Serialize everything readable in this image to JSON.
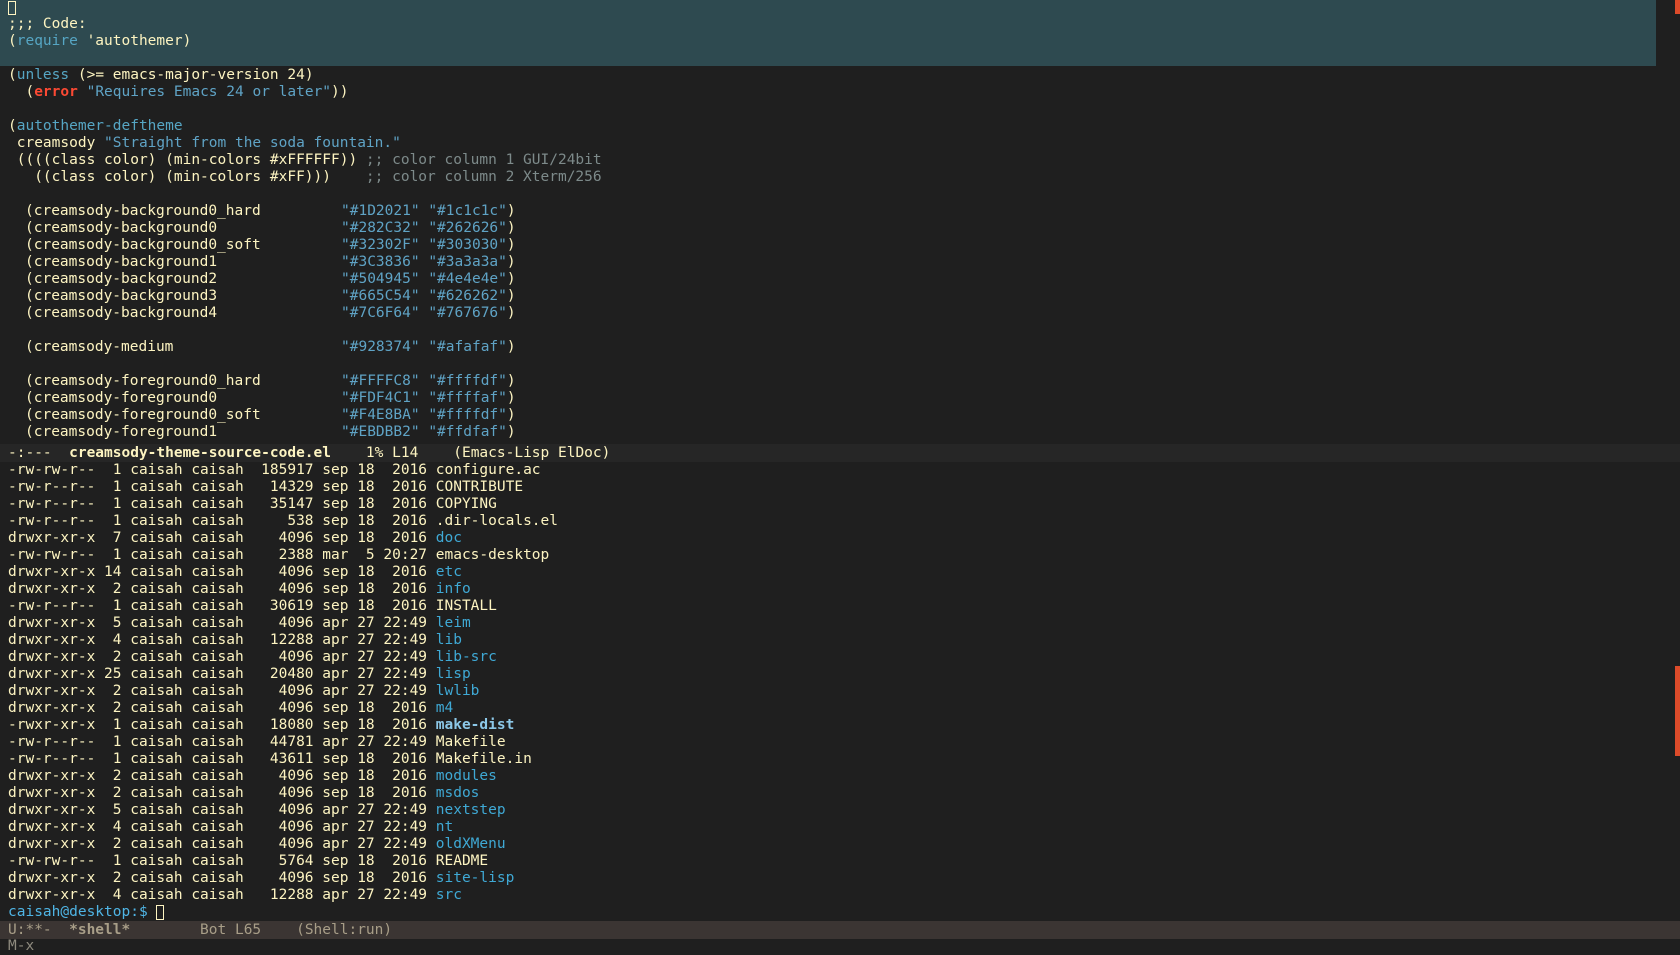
{
  "editor": {
    "comment_code": ";;; Code:",
    "require_kw": "require",
    "require_arg": " 'autothemer)",
    "unless_kw": "unless",
    "unless_rest": " (>= emacs-major-version 24)",
    "error_kw": "error",
    "error_str": "\"Requires Emacs 24 or later\"",
    "deftheme_kw": "autothemer-deftheme",
    "theme_name": " creamsody ",
    "theme_desc": "\"Straight from the soda fountain.\"",
    "class1": " ((((class color) (min-colors #xFFFFFF)) ",
    "class1_comment": ";; color column 1 GUI/24bit",
    "class2": "   ((class color) (min-colors #xFF)))    ",
    "class2_comment": ";; color column 2 Xterm/256",
    "colors": [
      {
        "name": "(creamsody-background0_hard",
        "c1": "\"#1D2021\"",
        "c2": "\"#1c1c1c\""
      },
      {
        "name": "(creamsody-background0",
        "c1": "\"#282C32\"",
        "c2": "\"#262626\""
      },
      {
        "name": "(creamsody-background0_soft",
        "c1": "\"#32302F\"",
        "c2": "\"#303030\""
      },
      {
        "name": "(creamsody-background1",
        "c1": "\"#3C3836\"",
        "c2": "\"#3a3a3a\""
      },
      {
        "name": "(creamsody-background2",
        "c1": "\"#504945\"",
        "c2": "\"#4e4e4e\""
      },
      {
        "name": "(creamsody-background3",
        "c1": "\"#665C54\"",
        "c2": "\"#626262\""
      },
      {
        "name": "(creamsody-background4",
        "c1": "\"#7C6F64\"",
        "c2": "\"#767676\""
      },
      {
        "name": "(creamsody-medium",
        "c1": "\"#928374\"",
        "c2": "\"#afafaf\""
      },
      {
        "name": "(creamsody-foreground0_hard",
        "c1": "\"#FFFFC8\"",
        "c2": "\"#ffffdf\""
      },
      {
        "name": "(creamsody-foreground0",
        "c1": "\"#FDF4C1\"",
        "c2": "\"#ffffaf\""
      },
      {
        "name": "(creamsody-foreground0_soft",
        "c1": "\"#F4E8BA\"",
        "c2": "\"#ffffdf\""
      },
      {
        "name": "(creamsody-foreground1",
        "c1": "\"#EBDBB2\"",
        "c2": "\"#ffdfaf\""
      }
    ]
  },
  "mode_line_top": {
    "status": "-:---  ",
    "buffer": "creamsody-theme-source-code.el",
    "position": "    1% L14    ",
    "modes": "(Emacs-Lisp ElDoc)"
  },
  "listing": [
    {
      "perm": "-rw-rw-r--",
      "links": "1",
      "user": "caisah",
      "group": "caisah",
      "size": "185917",
      "month": "sep",
      "day": "18",
      "time": "2016",
      "name": "configure.ac",
      "kind": "file"
    },
    {
      "perm": "-rw-r--r--",
      "links": "1",
      "user": "caisah",
      "group": "caisah",
      "size": "14329",
      "month": "sep",
      "day": "18",
      "time": "2016",
      "name": "CONTRIBUTE",
      "kind": "file"
    },
    {
      "perm": "-rw-r--r--",
      "links": "1",
      "user": "caisah",
      "group": "caisah",
      "size": "35147",
      "month": "sep",
      "day": "18",
      "time": "2016",
      "name": "COPYING",
      "kind": "file"
    },
    {
      "perm": "-rw-r--r--",
      "links": "1",
      "user": "caisah",
      "group": "caisah",
      "size": "538",
      "month": "sep",
      "day": "18",
      "time": "2016",
      "name": ".dir-locals.el",
      "kind": "file"
    },
    {
      "perm": "drwxr-xr-x",
      "links": "7",
      "user": "caisah",
      "group": "caisah",
      "size": "4096",
      "month": "sep",
      "day": "18",
      "time": "2016",
      "name": "doc",
      "kind": "dir"
    },
    {
      "perm": "-rw-rw-r--",
      "links": "1",
      "user": "caisah",
      "group": "caisah",
      "size": "2388",
      "month": "mar",
      "day": "5",
      "time": "20:27",
      "name": "emacs-desktop",
      "kind": "file"
    },
    {
      "perm": "drwxr-xr-x",
      "links": "14",
      "user": "caisah",
      "group": "caisah",
      "size": "4096",
      "month": "sep",
      "day": "18",
      "time": "2016",
      "name": "etc",
      "kind": "dir"
    },
    {
      "perm": "drwxr-xr-x",
      "links": "2",
      "user": "caisah",
      "group": "caisah",
      "size": "4096",
      "month": "sep",
      "day": "18",
      "time": "2016",
      "name": "info",
      "kind": "dir"
    },
    {
      "perm": "-rw-r--r--",
      "links": "1",
      "user": "caisah",
      "group": "caisah",
      "size": "30619",
      "month": "sep",
      "day": "18",
      "time": "2016",
      "name": "INSTALL",
      "kind": "file"
    },
    {
      "perm": "drwxr-xr-x",
      "links": "5",
      "user": "caisah",
      "group": "caisah",
      "size": "4096",
      "month": "apr",
      "day": "27",
      "time": "22:49",
      "name": "leim",
      "kind": "dir"
    },
    {
      "perm": "drwxr-xr-x",
      "links": "4",
      "user": "caisah",
      "group": "caisah",
      "size": "12288",
      "month": "apr",
      "day": "27",
      "time": "22:49",
      "name": "lib",
      "kind": "dir"
    },
    {
      "perm": "drwxr-xr-x",
      "links": "2",
      "user": "caisah",
      "group": "caisah",
      "size": "4096",
      "month": "apr",
      "day": "27",
      "time": "22:49",
      "name": "lib-src",
      "kind": "dir"
    },
    {
      "perm": "drwxr-xr-x",
      "links": "25",
      "user": "caisah",
      "group": "caisah",
      "size": "20480",
      "month": "apr",
      "day": "27",
      "time": "22:49",
      "name": "lisp",
      "kind": "dir"
    },
    {
      "perm": "drwxr-xr-x",
      "links": "2",
      "user": "caisah",
      "group": "caisah",
      "size": "4096",
      "month": "apr",
      "day": "27",
      "time": "22:49",
      "name": "lwlib",
      "kind": "dir"
    },
    {
      "perm": "drwxr-xr-x",
      "links": "2",
      "user": "caisah",
      "group": "caisah",
      "size": "4096",
      "month": "sep",
      "day": "18",
      "time": "2016",
      "name": "m4",
      "kind": "dir"
    },
    {
      "perm": "-rwxr-xr-x",
      "links": "1",
      "user": "caisah",
      "group": "caisah",
      "size": "18080",
      "month": "sep",
      "day": "18",
      "time": "2016",
      "name": "make-dist",
      "kind": "exe"
    },
    {
      "perm": "-rw-r--r--",
      "links": "1",
      "user": "caisah",
      "group": "caisah",
      "size": "44781",
      "month": "apr",
      "day": "27",
      "time": "22:49",
      "name": "Makefile",
      "kind": "file"
    },
    {
      "perm": "-rw-r--r--",
      "links": "1",
      "user": "caisah",
      "group": "caisah",
      "size": "43611",
      "month": "sep",
      "day": "18",
      "time": "2016",
      "name": "Makefile.in",
      "kind": "file"
    },
    {
      "perm": "drwxr-xr-x",
      "links": "2",
      "user": "caisah",
      "group": "caisah",
      "size": "4096",
      "month": "sep",
      "day": "18",
      "time": "2016",
      "name": "modules",
      "kind": "dir"
    },
    {
      "perm": "drwxr-xr-x",
      "links": "2",
      "user": "caisah",
      "group": "caisah",
      "size": "4096",
      "month": "sep",
      "day": "18",
      "time": "2016",
      "name": "msdos",
      "kind": "dir"
    },
    {
      "perm": "drwxr-xr-x",
      "links": "5",
      "user": "caisah",
      "group": "caisah",
      "size": "4096",
      "month": "apr",
      "day": "27",
      "time": "22:49",
      "name": "nextstep",
      "kind": "dir"
    },
    {
      "perm": "drwxr-xr-x",
      "links": "4",
      "user": "caisah",
      "group": "caisah",
      "size": "4096",
      "month": "apr",
      "day": "27",
      "time": "22:49",
      "name": "nt",
      "kind": "dir"
    },
    {
      "perm": "drwxr-xr-x",
      "links": "2",
      "user": "caisah",
      "group": "caisah",
      "size": "4096",
      "month": "apr",
      "day": "27",
      "time": "22:49",
      "name": "oldXMenu",
      "kind": "dir"
    },
    {
      "perm": "-rw-rw-r--",
      "links": "1",
      "user": "caisah",
      "group": "caisah",
      "size": "5764",
      "month": "sep",
      "day": "18",
      "time": "2016",
      "name": "README",
      "kind": "file"
    },
    {
      "perm": "drwxr-xr-x",
      "links": "2",
      "user": "caisah",
      "group": "caisah",
      "size": "4096",
      "month": "sep",
      "day": "18",
      "time": "2016",
      "name": "site-lisp",
      "kind": "dir"
    },
    {
      "perm": "drwxr-xr-x",
      "links": "4",
      "user": "caisah",
      "group": "caisah",
      "size": "12288",
      "month": "apr",
      "day": "27",
      "time": "22:49",
      "name": "src",
      "kind": "dir"
    }
  ],
  "shell": {
    "prompt": "caisah@desktop:$ "
  },
  "mode_line_bottom": {
    "status": "U:**-  ",
    "buffer": "*shell*",
    "position": "        Bot L65    ",
    "modes": "(Shell:run)"
  },
  "minibuffer": "M-x"
}
